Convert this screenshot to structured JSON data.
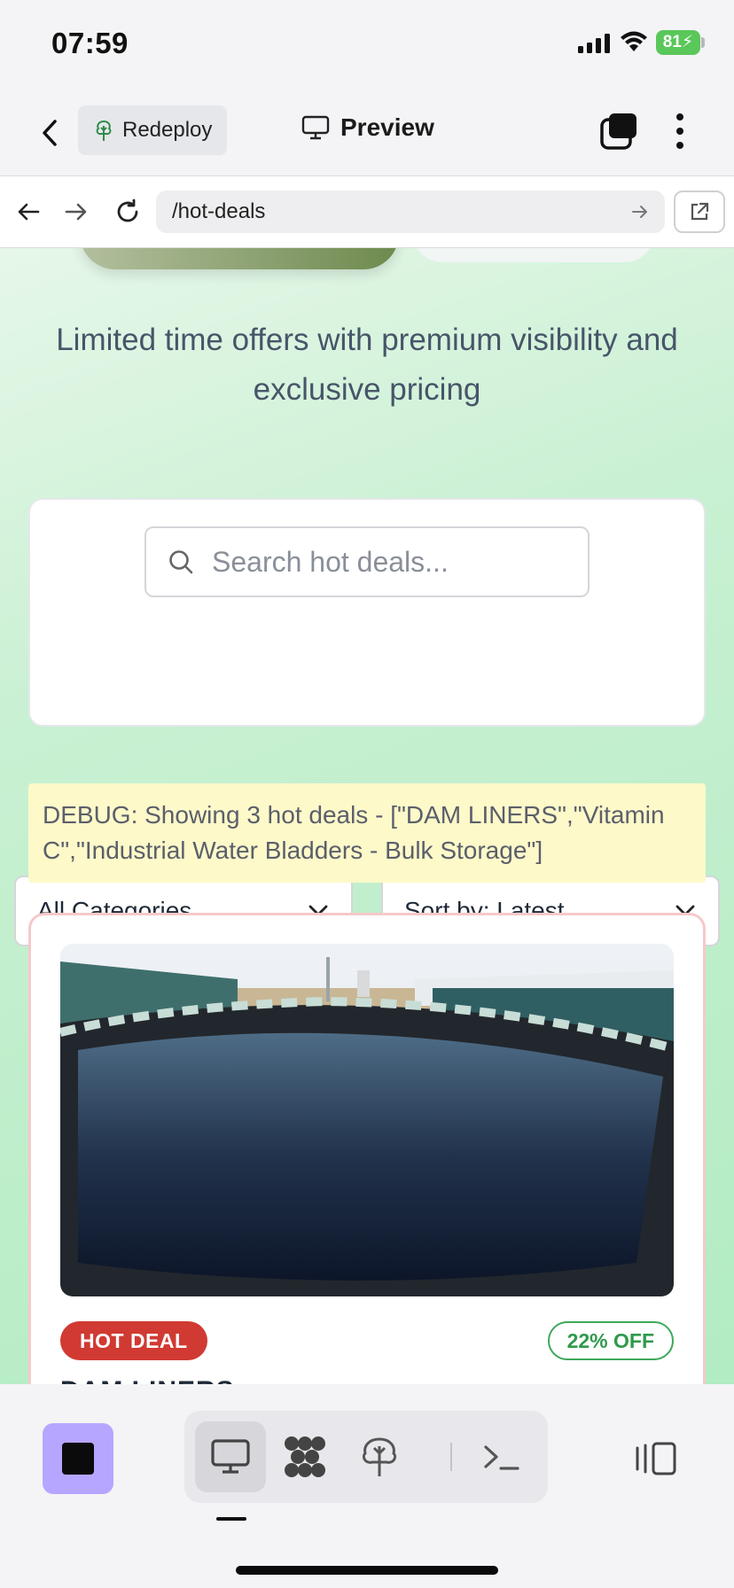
{
  "status_bar": {
    "time": "07:59",
    "battery": "81"
  },
  "header": {
    "redeploy_label": "Redeploy",
    "preview_label": "Preview"
  },
  "url_bar": {
    "path": "/hot-deals"
  },
  "page": {
    "subtitle": "Limited time offers with premium visibility and exclusive pricing",
    "search_placeholder": "Search hot deals...",
    "category_select": "All Categories",
    "sort_select": "Sort by: Latest",
    "debug_text": "DEBUG: Showing 3 hot deals - [\"DAM LINERS\",\"Vitamin C\",\"Industrial Water Bladders - Bulk Storage\"]",
    "deal": {
      "hot_badge": "HOT DEAL",
      "discount_badge": "22% OFF",
      "title": "DAM LINERS"
    }
  },
  "colors": {
    "accent_purple": "#b7a6ff",
    "hot_red": "#d03a32",
    "discount_green": "#3fa85a",
    "debug_yellow": "#fdf9c9"
  },
  "icons": [
    "back-icon",
    "redeploy-tree-icon",
    "monitor-icon",
    "tabs-icon",
    "more-icon",
    "arrow-left-icon",
    "arrow-right-icon",
    "reload-icon",
    "go-arrow-icon",
    "external-link-icon",
    "search-icon",
    "chevron-down-icon",
    "stop-icon",
    "grid-dots-icon",
    "deploy-icon",
    "terminal-icon",
    "split-view-icon"
  ]
}
